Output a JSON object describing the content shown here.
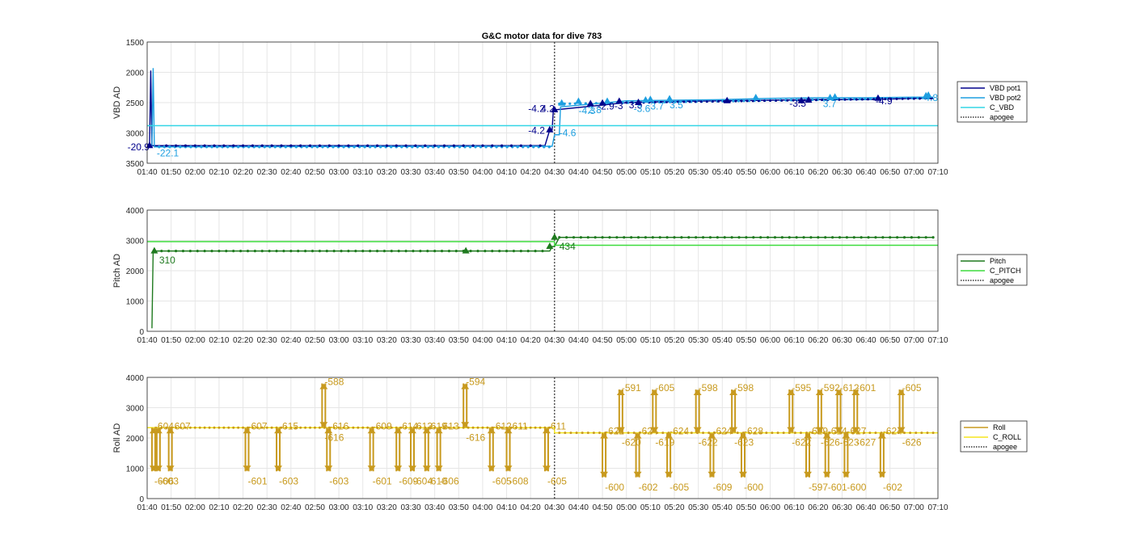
{
  "figure": {
    "title": "G&C motor data for dive 783"
  },
  "chart_data": [
    {
      "type": "line",
      "ylabel": "VBD AD",
      "ylim": [
        1500,
        3500
      ],
      "yreverse": true,
      "yticks": [
        "1500",
        "2000",
        "2500",
        "3000",
        "3500"
      ],
      "xticks": [
        "01:40",
        "01:50",
        "02:00",
        "02:10",
        "02:20",
        "02:30",
        "02:40",
        "02:50",
        "03:00",
        "03:10",
        "03:20",
        "03:30",
        "03:40",
        "03:50",
        "04:00",
        "04:10",
        "04:20",
        "04:30",
        "04:40",
        "04:50",
        "05:00",
        "05:10",
        "05:20",
        "05:30",
        "05:40",
        "05:50",
        "06:00",
        "06:10",
        "06:20",
        "06:30",
        "06:40",
        "06:50",
        "07:00",
        "07:10"
      ],
      "xlim": [
        100,
        430
      ],
      "apogee": 270,
      "grid": true,
      "legend": {
        "position": "right",
        "entries": [
          {
            "name": "VBD pot1",
            "color": "#00008b",
            "style": "solid"
          },
          {
            "name": "VBD pot2",
            "color": "#1e9fe0",
            "style": "solid"
          },
          {
            "name": "C_VBD",
            "color": "#33d6e6",
            "style": "solid"
          },
          {
            "name": "apogee",
            "color": "#333333",
            "style": "dotted"
          }
        ]
      },
      "series": [
        {
          "name": "VBD pot1",
          "color": "#00008b",
          "x": [
            101,
            101.5,
            102,
            265,
            266,
            268,
            269,
            269.5,
            270,
            300,
            320,
            340,
            360,
            380,
            400,
            420,
            428
          ],
          "y": [
            3210,
            1970,
            3210,
            3210,
            3210,
            2950,
            2950,
            2620,
            2620,
            2500,
            2480,
            2470,
            2460,
            2450,
            2450,
            2430,
            2430
          ]
        },
        {
          "name": "VBD pot2",
          "color": "#1e9fe0",
          "x": [
            102,
            102.5,
            103,
            268,
            269,
            270,
            272,
            272.5,
            300,
            320,
            340,
            360,
            380,
            400,
            420,
            428
          ],
          "y": [
            3230,
            1930,
            3230,
            3220,
            3220,
            3030,
            3030,
            2570,
            2470,
            2460,
            2450,
            2430,
            2420,
            2420,
            2410,
            2410
          ],
          "marker_interval": [
            105,
            268
          ]
        },
        {
          "name": "C_VBD",
          "color": "#33d6e6",
          "x": [
            100,
            430
          ],
          "y": [
            2880,
            2880
          ]
        }
      ],
      "segments": [
        {
          "x_start": 101,
          "x_end": 102,
          "color": "#00008b",
          "markers": [
            {
              "x": 101,
              "y": 3210
            }
          ]
        },
        {
          "x_start": 268,
          "x_end": 271,
          "color": "#00008b",
          "markers": [
            {
              "x": 268,
              "y": 2950
            },
            {
              "x": 270,
              "y": 2620
            }
          ]
        },
        {
          "x_start": 272,
          "x_end": 428,
          "color": "#00008b",
          "markers": [
            {
              "x": 285,
              "y": 2520
            },
            {
              "x": 290,
              "y": 2510
            },
            {
              "x": 297,
              "y": 2480
            },
            {
              "x": 305,
              "y": 2500
            },
            {
              "x": 342,
              "y": 2470
            },
            {
              "x": 373,
              "y": 2470
            },
            {
              "x": 376,
              "y": 2460
            },
            {
              "x": 405,
              "y": 2430
            }
          ]
        },
        {
          "x_start": 272,
          "x_end": 428,
          "color": "#1e9fe0",
          "markers": [
            {
              "x": 273,
              "y": 2510
            },
            {
              "x": 280,
              "y": 2480
            },
            {
              "x": 292,
              "y": 2480
            },
            {
              "x": 308,
              "y": 2460
            },
            {
              "x": 310,
              "y": 2450
            },
            {
              "x": 318,
              "y": 2440
            },
            {
              "x": 354,
              "y": 2420
            },
            {
              "x": 385,
              "y": 2420
            },
            {
              "x": 387,
              "y": 2410
            },
            {
              "x": 426,
              "y": 2380
            },
            {
              "x": 425,
              "y": 2390
            }
          ]
        }
      ],
      "labels": [
        {
          "text": "-20.9",
          "x": 101,
          "y": 3230,
          "color": "#00008b",
          "anchor": "end"
        },
        {
          "text": "-22.1",
          "x": 104,
          "y": 3330,
          "color": "#1e9fe0",
          "anchor": "start"
        },
        {
          "text": "-4.2",
          "x": 266,
          "y": 2600,
          "color": "#00008b",
          "anchor": "end"
        },
        {
          "text": "-4.2",
          "x": 266,
          "y": 2960,
          "color": "#00008b",
          "anchor": "end"
        },
        {
          "text": "-4.6",
          "x": 272,
          "y": 3000,
          "color": "#1e9fe0",
          "anchor": "start"
        },
        {
          "text": "4.2",
          "x": 270,
          "y": 2600,
          "color": "#00008b",
          "anchor": "end"
        },
        {
          "text": "-4.3",
          "x": 280,
          "y": 2630,
          "color": "#1e9fe0",
          "anchor": "start"
        },
        {
          "text": "2.8",
          "x": 284,
          "y": 2620,
          "color": "#1e9fe0",
          "anchor": "start"
        },
        {
          "text": "-2.9",
          "x": 288,
          "y": 2560,
          "color": "#00008b",
          "anchor": "start"
        },
        {
          "text": "-3",
          "x": 295,
          "y": 2550,
          "color": "#00008b",
          "anchor": "start"
        },
        {
          "text": "3.5",
          "x": 301,
          "y": 2540,
          "color": "#00008b",
          "anchor": "start"
        },
        {
          "text": "-3.6",
          "x": 303,
          "y": 2600,
          "color": "#1e9fe0",
          "anchor": "start"
        },
        {
          "text": "3.7",
          "x": 310,
          "y": 2560,
          "color": "#1e9fe0",
          "anchor": "start"
        },
        {
          "text": "3.5",
          "x": 318,
          "y": 2540,
          "color": "#1e9fe0",
          "anchor": "start"
        },
        {
          "text": "-3.5",
          "x": 368,
          "y": 2510,
          "color": "#00008b",
          "anchor": "start"
        },
        {
          "text": "3.7",
          "x": 382,
          "y": 2520,
          "color": "#1e9fe0",
          "anchor": "start"
        },
        {
          "text": "-4.9",
          "x": 404,
          "y": 2470,
          "color": "#00008b",
          "anchor": "start"
        },
        {
          "text": "-4.8",
          "x": 430,
          "y": 2420,
          "color": "#1e9fe0",
          "anchor": "end"
        }
      ]
    },
    {
      "type": "line",
      "ylabel": "Pitch AD",
      "ylim": [
        0,
        4000
      ],
      "yticks": [
        "4000",
        "3000",
        "2000",
        "1000",
        "0"
      ],
      "xticks": [
        "01:40",
        "01:50",
        "02:00",
        "02:10",
        "02:20",
        "02:30",
        "02:40",
        "02:50",
        "03:00",
        "03:10",
        "03:20",
        "03:30",
        "03:40",
        "03:50",
        "04:00",
        "04:10",
        "04:20",
        "04:30",
        "04:40",
        "04:50",
        "05:00",
        "05:10",
        "05:20",
        "05:30",
        "05:40",
        "05:50",
        "06:00",
        "06:10",
        "06:20",
        "06:30",
        "06:40",
        "06:50",
        "07:00",
        "07:10"
      ],
      "xlim": [
        100,
        430
      ],
      "apogee": 270,
      "grid": true,
      "legend": {
        "position": "right",
        "entries": [
          {
            "name": "Pitch",
            "color": "#1f7a1f",
            "style": "solid"
          },
          {
            "name": "C_PITCH",
            "color": "#3ddc3d",
            "style": "solid"
          },
          {
            "name": "apogee",
            "color": "#333333",
            "style": "dotted"
          }
        ]
      },
      "series": [
        {
          "name": "Pitch",
          "color": "#1f7a1f",
          "x": [
            102,
            102.5,
            103,
            268,
            269,
            270,
            272,
            300,
            340,
            380,
            410,
            428
          ],
          "y": [
            100,
            2650,
            2650,
            2650,
            2800,
            2800,
            3100,
            3100,
            3100,
            3100,
            3100,
            3100
          ]
        },
        {
          "name": "C_PITCH",
          "color": "#3ddc3d",
          "x": [
            100,
            270,
            270,
            430
          ],
          "y": [
            2960,
            2960,
            2840,
            2840
          ]
        }
      ],
      "markers": [
        {
          "x": 103,
          "y": 2650,
          "color": "#1f7a1f"
        },
        {
          "x": 233,
          "y": 2650,
          "color": "#1f7a1f"
        },
        {
          "x": 268,
          "y": 2800,
          "color": "#1f7a1f"
        },
        {
          "x": 270,
          "y": 3100,
          "color": "#1f7a1f"
        }
      ],
      "labels": [
        {
          "text": "310",
          "x": 105,
          "y": 2350,
          "color": "#1f7a1f",
          "anchor": "start"
        },
        {
          "text": "434",
          "x": 272,
          "y": 2800,
          "color": "#1f7a1f",
          "anchor": "start"
        }
      ]
    },
    {
      "type": "line",
      "ylabel": "Roll AD",
      "ylim": [
        0,
        4000
      ],
      "yticks": [
        "4000",
        "3000",
        "2000",
        "1000",
        "0"
      ],
      "xticks": [
        "01:40",
        "01:50",
        "02:00",
        "02:10",
        "02:20",
        "02:30",
        "02:40",
        "02:50",
        "03:00",
        "03:10",
        "03:20",
        "03:30",
        "03:40",
        "03:50",
        "04:00",
        "04:10",
        "04:20",
        "04:30",
        "04:40",
        "04:50",
        "05:00",
        "05:10",
        "05:20",
        "05:30",
        "05:40",
        "05:50",
        "06:00",
        "06:10",
        "06:20",
        "06:30",
        "06:40",
        "06:50",
        "07:00",
        "07:10"
      ],
      "xlim": [
        100,
        430
      ],
      "apogee": 270,
      "grid": true,
      "legend": {
        "position": "right",
        "entries": [
          {
            "name": "Roll",
            "color": "#c89a1e",
            "style": "solid"
          },
          {
            "name": "C_ROLL",
            "color": "#f5e61e",
            "style": "solid"
          },
          {
            "name": "apogee",
            "color": "#333333",
            "style": "dotted"
          }
        ]
      },
      "series": [
        {
          "name": "C_ROLL",
          "color": "#f5e61e",
          "x": [
            100,
            270,
            270,
            430
          ],
          "y": [
            2340,
            2340,
            2170,
            2170
          ]
        }
      ],
      "pulses": [
        {
          "x": 102,
          "y_base": 2340,
          "y_peak": 900,
          "label_top": "-604",
          "label_bot": "-606"
        },
        {
          "x": 104,
          "y_base": 2340,
          "y_peak": 900,
          "label_top": "",
          "label_bot": "-603"
        },
        {
          "x": 109,
          "y_base": 900,
          "y_peak": 2340,
          "label_top": "-607",
          "label_bot": ""
        },
        {
          "x": 141,
          "y_base": 2340,
          "y_peak": 900,
          "label_top": "-607",
          "label_bot": "-601"
        },
        {
          "x": 154,
          "y_base": 2340,
          "y_peak": 900,
          "label_top": "-615",
          "label_bot": "-603"
        },
        {
          "x": 173,
          "y_base": 2340,
          "y_peak": 3800,
          "label_top": "-588",
          "label_bot": "-616"
        },
        {
          "x": 175,
          "y_base": 2340,
          "y_peak": 900,
          "label_top": "-616",
          "label_bot": "-603"
        },
        {
          "x": 193,
          "y_base": 900,
          "y_peak": 2340,
          "label_top": "-609",
          "label_bot": "-601"
        },
        {
          "x": 204,
          "y_base": 900,
          "y_peak": 2340,
          "label_top": "-614",
          "label_bot": "-609"
        },
        {
          "x": 210,
          "y_base": 900,
          "y_peak": 2340,
          "label_top": "-613",
          "label_bot": "-604"
        },
        {
          "x": 216,
          "y_base": 900,
          "y_peak": 2340,
          "label_top": "-619",
          "label_bot": "-610"
        },
        {
          "x": 221,
          "y_base": 900,
          "y_peak": 2340,
          "label_top": "-613",
          "label_bot": "-606"
        },
        {
          "x": 232,
          "y_base": 2340,
          "y_peak": 3800,
          "label_top": "-594",
          "label_bot": "-616"
        },
        {
          "x": 243,
          "y_base": 2340,
          "y_peak": 900,
          "label_top": "-612",
          "label_bot": "-605"
        },
        {
          "x": 250,
          "y_base": 900,
          "y_peak": 2340,
          "label_top": "-611",
          "label_bot": "-608"
        },
        {
          "x": 266,
          "y_base": 2340,
          "y_peak": 900,
          "label_top": "-611",
          "label_bot": "-605"
        },
        {
          "x": 290,
          "y_base": 2170,
          "y_peak": 700,
          "label_top": "-622",
          "label_bot": "-600"
        },
        {
          "x": 297,
          "y_base": 2170,
          "y_peak": 3600,
          "label_top": "-591",
          "label_bot": "-620"
        },
        {
          "x": 304,
          "y_base": 2170,
          "y_peak": 700,
          "label_top": "-624",
          "label_bot": "-602"
        },
        {
          "x": 311,
          "y_base": 2170,
          "y_peak": 3600,
          "label_top": "-605",
          "label_bot": "-619"
        },
        {
          "x": 317,
          "y_base": 2170,
          "y_peak": 700,
          "label_top": "-624",
          "label_bot": "-605"
        },
        {
          "x": 329,
          "y_base": 2170,
          "y_peak": 3600,
          "label_top": "-598",
          "label_bot": "-622"
        },
        {
          "x": 335,
          "y_base": 2170,
          "y_peak": 700,
          "label_top": "-624",
          "label_bot": "-609"
        },
        {
          "x": 344,
          "y_base": 2170,
          "y_peak": 3600,
          "label_top": "-598",
          "label_bot": "-623"
        },
        {
          "x": 348,
          "y_base": 2170,
          "y_peak": 700,
          "label_top": "-628",
          "label_bot": "-600"
        },
        {
          "x": 368,
          "y_base": 2170,
          "y_peak": 3600,
          "label_top": "-595",
          "label_bot": "-622"
        },
        {
          "x": 375,
          "y_base": 2170,
          "y_peak": 700,
          "label_top": "-619",
          "label_bot": "-597"
        },
        {
          "x": 380,
          "y_base": 2170,
          "y_peak": 3600,
          "label_top": "-592",
          "label_bot": "-626"
        },
        {
          "x": 383,
          "y_base": 2170,
          "y_peak": 700,
          "label_top": "-614",
          "label_bot": "-601"
        },
        {
          "x": 388,
          "y_base": 2170,
          "y_peak": 3600,
          "label_top": "-612",
          "label_bot": "-623"
        },
        {
          "x": 391,
          "y_base": 2170,
          "y_peak": 700,
          "label_top": "-627",
          "label_bot": "-600"
        },
        {
          "x": 395,
          "y_base": 2170,
          "y_peak": 3600,
          "label_top": "-601",
          "label_bot": "-627"
        },
        {
          "x": 406,
          "y_base": 2170,
          "y_peak": 700,
          "label_top": "-624",
          "label_bot": "-602"
        },
        {
          "x": 414,
          "y_base": 2170,
          "y_peak": 3600,
          "label_top": "-605",
          "label_bot": "-626"
        }
      ]
    }
  ]
}
